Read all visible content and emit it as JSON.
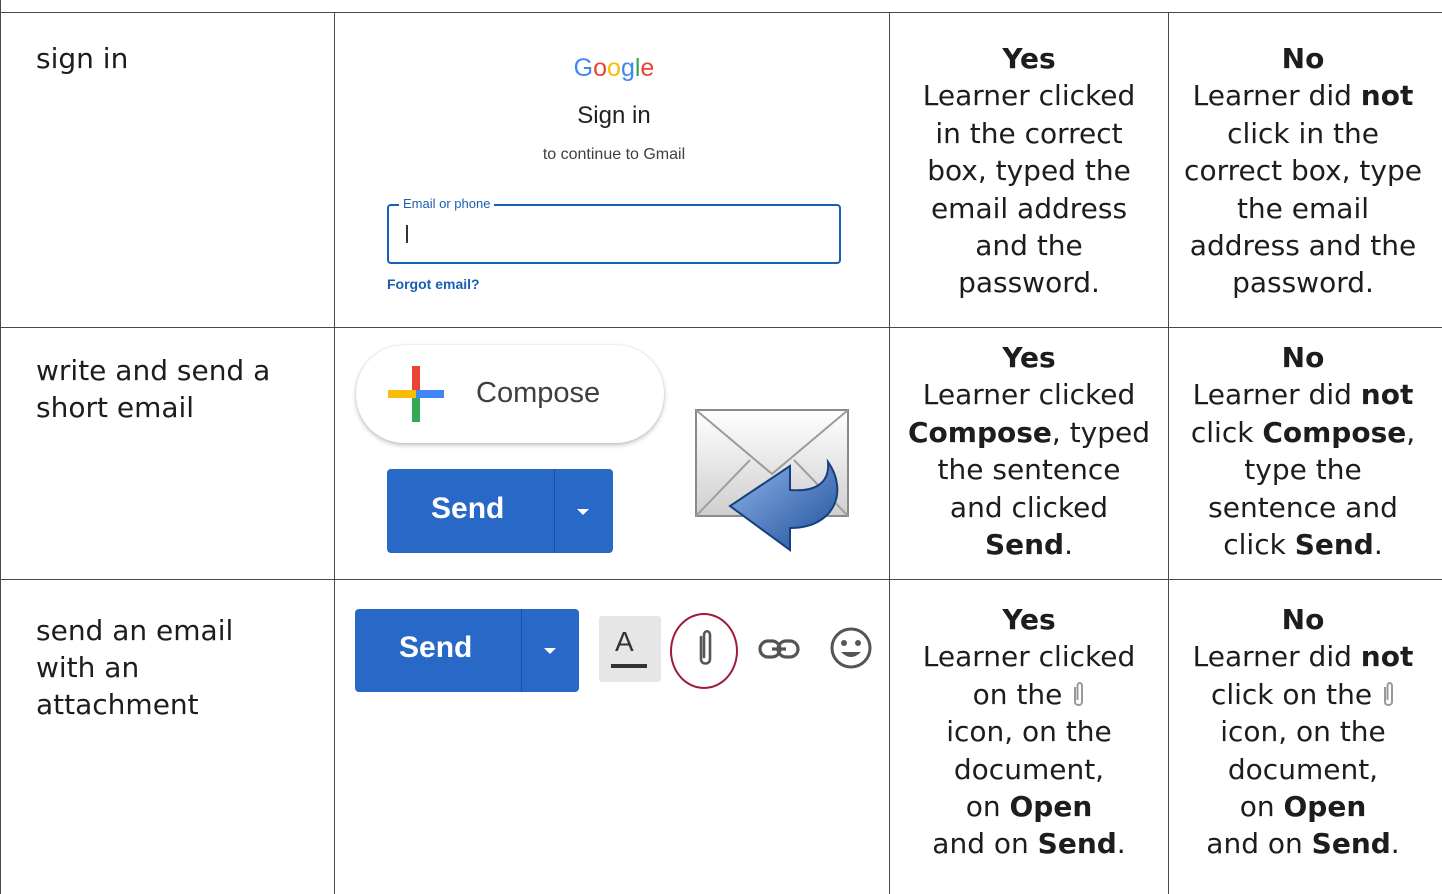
{
  "rows": [
    {
      "task": "sign in",
      "yes": {
        "head": "Yes",
        "lines": [
          "Learner clicked",
          "in the correct",
          "box, typed the",
          "email address",
          "and the",
          "password."
        ]
      },
      "no": {
        "head": "No",
        "l1a": "Learner did ",
        "l1b": "not",
        "lines": [
          "click in the",
          "correct box, type",
          "the email",
          "address and the",
          "password."
        ]
      },
      "google": {
        "logo": [
          "G",
          "o",
          "o",
          "g",
          "l",
          "e"
        ],
        "logo_colors": [
          "#4285f4",
          "#ea4335",
          "#fbbc05",
          "#4285f4",
          "#34a853",
          "#ea4335"
        ],
        "title": "Sign in",
        "subtitle": "to continue to Gmail",
        "field_label": "Email or phone",
        "field_value": "",
        "forgot": "Forgot email?"
      }
    },
    {
      "task_l1": "write and send a",
      "task_l2": "short email",
      "compose_label": "Compose",
      "send_label": "Send",
      "yes": {
        "head": "Yes",
        "l1": "Learner clicked",
        "l2b": "Compose",
        "l2a": ", typed",
        "l3": "the sentence",
        "l4": "and clicked",
        "l5b": "Send",
        "l5a": "."
      },
      "no": {
        "head": "No",
        "l1a": "Learner did ",
        "l1b": "not",
        "l2a": "click ",
        "l2b": "Compose",
        "l2c": ",",
        "l3": "type the",
        "l4": "sentence and",
        "l5a": "click ",
        "l5b": "Send",
        "l5c": "."
      }
    },
    {
      "task_l1": "send an email",
      "task_l2": "with an",
      "task_l3": "attachment",
      "send_label": "Send",
      "format_letter": "A",
      "toolbar_icons": [
        "format-text-icon",
        "paperclip-icon",
        "link-icon",
        "emoji-icon"
      ],
      "highlight_color": "#a11a3a",
      "yes": {
        "head": "Yes",
        "l1": "Learner clicked",
        "l2": "on the",
        "l3": "icon, on the",
        "l4": "document,",
        "l5a": "on ",
        "l5b": "Open",
        "l6a": "and on ",
        "l6b": "Send",
        "l6c": "."
      },
      "no": {
        "head": "No",
        "l1a": "Learner did ",
        "l1b": "not",
        "l2": "click on the",
        "l3": "icon, on the",
        "l4": "document,",
        "l5a": "on ",
        "l5b": "Open",
        "l6a": "and on ",
        "l6b": "Send",
        "l6c": "."
      }
    }
  ],
  "colors": {
    "google_blue": "#1a5fb4",
    "send_blue": "#2868c6"
  }
}
